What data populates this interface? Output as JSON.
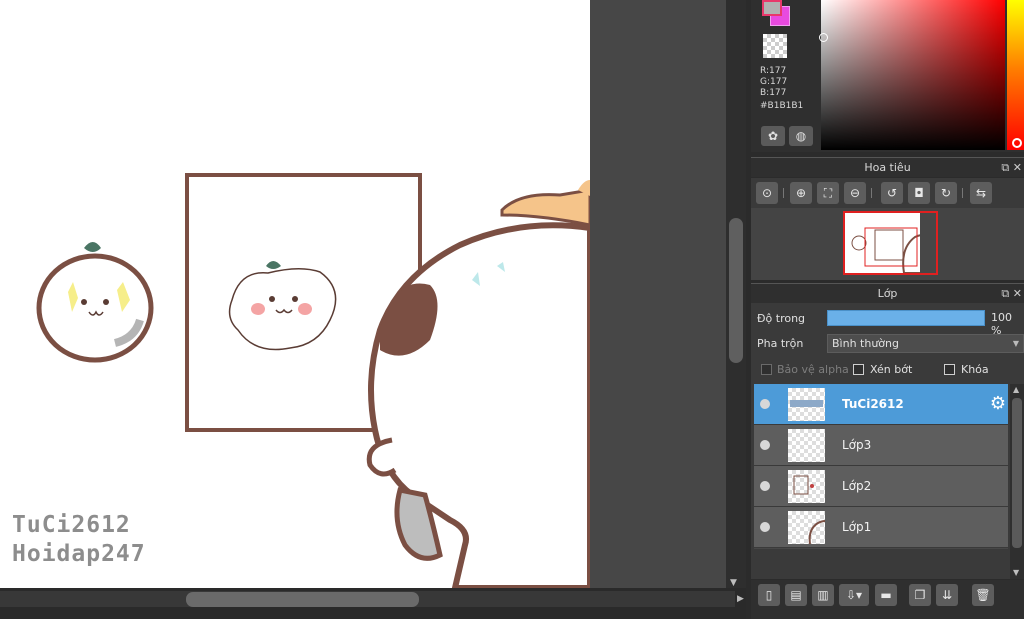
{
  "canvas": {
    "watermark_line1": "TuCi2612",
    "watermark_line2": "Hoidap247"
  },
  "color_panel": {
    "foreground_color": "#B1B1B1",
    "background_color": "#E84AE0",
    "r": "R:177",
    "g": "G:177",
    "b": "B:177",
    "hex": "#B1B1B1",
    "palette_icon": "palette-icon",
    "picker_icon": "color-wheel-icon"
  },
  "navigator": {
    "title": "Hoa tiêu",
    "tools": [
      "zoom-actual-icon",
      "zoom-in-icon",
      "fit-screen-icon",
      "zoom-out-icon",
      "rotate-left-icon",
      "reset-view-icon",
      "rotate-right-icon",
      "flip-horizontal-icon"
    ]
  },
  "layers_panel": {
    "title": "Lớp",
    "opacity_label": "Độ trong",
    "opacity_value": "100 %",
    "opacity_fraction": 1.0,
    "blend_label": "Pha trộn",
    "blend_value": "Bình thường",
    "protect_alpha_label": "Bảo vệ alpha",
    "clipping_label": "Xén bớt",
    "lock_label": "Khóa",
    "layers": [
      {
        "name": "TuCi2612",
        "selected": true
      },
      {
        "name": "Lớp3",
        "selected": false
      },
      {
        "name": "Lớp2",
        "selected": false
      },
      {
        "name": "Lớp1",
        "selected": false
      }
    ]
  },
  "accent_color": "#4D9BD8"
}
